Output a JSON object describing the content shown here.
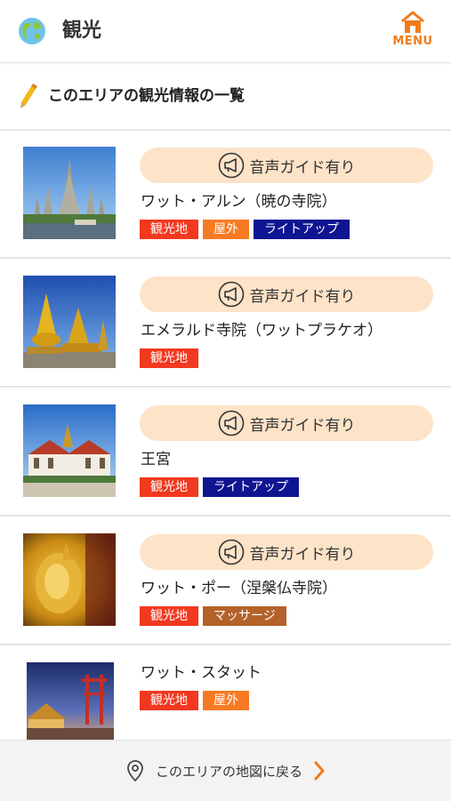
{
  "header": {
    "title": "観光",
    "menu_label": "MENU"
  },
  "section": {
    "title": "このエリアの観光情報の一覧"
  },
  "guide_label": "音声ガイド有り",
  "spots": [
    {
      "name": "ワット・アルン（暁の寺院）",
      "guide": true,
      "tags": [
        "観光地",
        "屋外",
        "ライトアップ"
      ]
    },
    {
      "name": "エメラルド寺院（ワットプラケオ）",
      "guide": true,
      "tags": [
        "観光地"
      ]
    },
    {
      "name": "王宮",
      "guide": true,
      "tags": [
        "観光地",
        "ライトアップ"
      ]
    },
    {
      "name": "ワット・ポー（涅槃仏寺院）",
      "guide": true,
      "tags": [
        "観光地",
        "マッサージ"
      ]
    },
    {
      "name": "ワット・スタット",
      "guide": false,
      "tags": [
        "観光地",
        "屋外"
      ]
    }
  ],
  "footer": {
    "label": "このエリアの地図に戻る"
  },
  "colors": {
    "accent": "#f07b1a",
    "guide_bg": "#fde3c8",
    "tag_sightseeing": "#f2381f",
    "tag_outdoor": "#f77a23",
    "tag_lightup": "#0f1491",
    "tag_massage": "#b4612a"
  }
}
